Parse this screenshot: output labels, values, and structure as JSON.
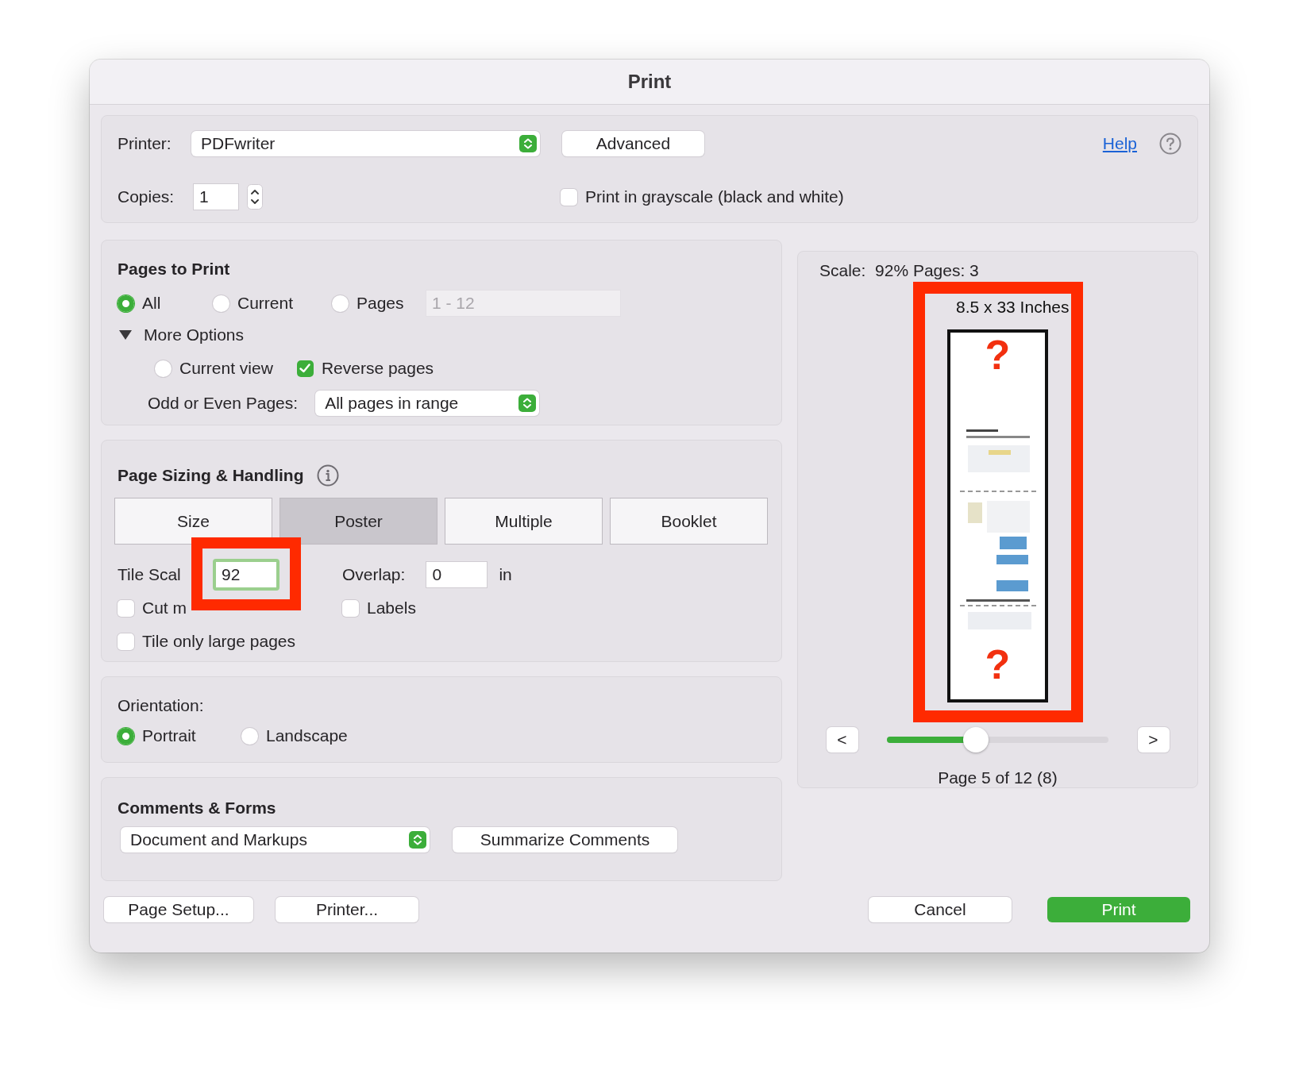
{
  "window": {
    "title": "Print"
  },
  "printer": {
    "label": "Printer:",
    "value": "PDFwriter",
    "advanced_button": "Advanced",
    "help_link": "Help"
  },
  "copies": {
    "label": "Copies:",
    "value": "1"
  },
  "grayscale": {
    "label": "Print in grayscale (black and white)",
    "checked": false
  },
  "pages_to_print": {
    "title": "Pages to Print",
    "options": [
      {
        "label": "All",
        "selected": true
      },
      {
        "label": "Current",
        "selected": false
      },
      {
        "label": "Pages",
        "selected": false
      }
    ],
    "range": {
      "value": "1 - 12",
      "disabled": true
    },
    "more_options": {
      "label": "More Options",
      "expanded": true,
      "current_view": {
        "label": "Current view",
        "selected": false
      },
      "reverse_pages": {
        "label": "Reverse pages",
        "checked": true
      },
      "odd_even": {
        "label": "Odd or Even Pages:",
        "value": "All pages in range"
      }
    }
  },
  "page_sizing": {
    "title": "Page Sizing & Handling",
    "tabs": [
      {
        "label": "Size",
        "selected": false
      },
      {
        "label": "Poster",
        "selected": true
      },
      {
        "label": "Multiple",
        "selected": false
      },
      {
        "label": "Booklet",
        "selected": false
      }
    ],
    "tile_scale": {
      "label": "Tile Scal",
      "value": "92",
      "highlighted": true
    },
    "overlap": {
      "label": "Overlap:",
      "value": "0",
      "unit": "in"
    },
    "cut_marks": {
      "label": "Cut m",
      "checked": false
    },
    "labels": {
      "label": "Labels",
      "checked": false
    },
    "tile_only_large": {
      "label": "Tile only large pages",
      "checked": false
    }
  },
  "orientation": {
    "title": "Orientation:",
    "options": [
      {
        "label": "Portrait",
        "selected": true
      },
      {
        "label": "Landscape",
        "selected": false
      }
    ]
  },
  "comments_forms": {
    "title": "Comments & Forms",
    "value": "Document and Markups",
    "summarize_button": "Summarize Comments"
  },
  "preview": {
    "scale_text": "Scale:  92% Pages: 3",
    "paper_size": "8.5 x 33 Inches",
    "highlighted": true,
    "marks": [
      "?",
      "?"
    ],
    "previous_button": "<",
    "next_button": ">",
    "slider": {
      "level": 0.38
    },
    "page_text": "Page 5 of 12 (8)"
  },
  "footer": {
    "left": [
      {
        "label": "Page Setup...",
        "kind": "plain"
      },
      {
        "label": "Printer...",
        "kind": "plain"
      }
    ],
    "right": [
      {
        "label": "Cancel",
        "kind": "plain"
      },
      {
        "label": "Print",
        "kind": "primary"
      }
    ]
  }
}
